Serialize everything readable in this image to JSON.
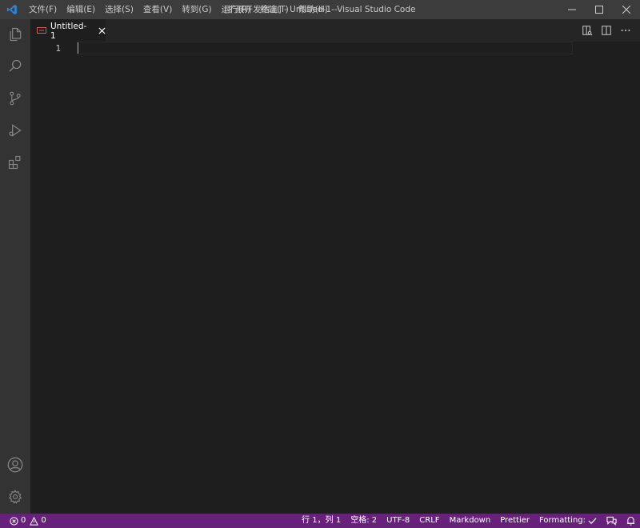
{
  "titlebar": {
    "menu": [
      {
        "label": "文件(F)"
      },
      {
        "label": "编辑(E)"
      },
      {
        "label": "选择(S)"
      },
      {
        "label": "查看(V)"
      },
      {
        "label": "转到(G)"
      },
      {
        "label": "运行(R)"
      },
      {
        "label": "终端(T)"
      },
      {
        "label": "帮助(H)"
      }
    ],
    "window_title": "[扩展开发宿主] - Untitled-1--Visual Studio Code"
  },
  "tabs": [
    {
      "label": "Untitled-1"
    }
  ],
  "editor": {
    "line_numbers": [
      "1"
    ]
  },
  "statusbar": {
    "errors": "0",
    "warnings": "0",
    "position": "行 1，列 1",
    "indent": "空格: 2",
    "encoding": "UTF-8",
    "eol": "CRLF",
    "language": "Markdown",
    "prettier": "Prettier",
    "formatting": "Formatting:"
  },
  "colors": {
    "titlebar": "#3c3c3c",
    "activitybar": "#333333",
    "editor": "#1e1e1e",
    "statusbar": "#68217a",
    "vscode_blue": "#2f80d1"
  },
  "icons": {
    "app": "vscode-logo-icon",
    "activity": [
      "explorer-icon",
      "search-icon",
      "source-control-icon",
      "run-debug-icon",
      "extensions-icon",
      "account-icon",
      "settings-gear-icon"
    ],
    "tab_actions": [
      "open-preview-icon",
      "split-editor-icon",
      "more-actions-icon"
    ]
  }
}
